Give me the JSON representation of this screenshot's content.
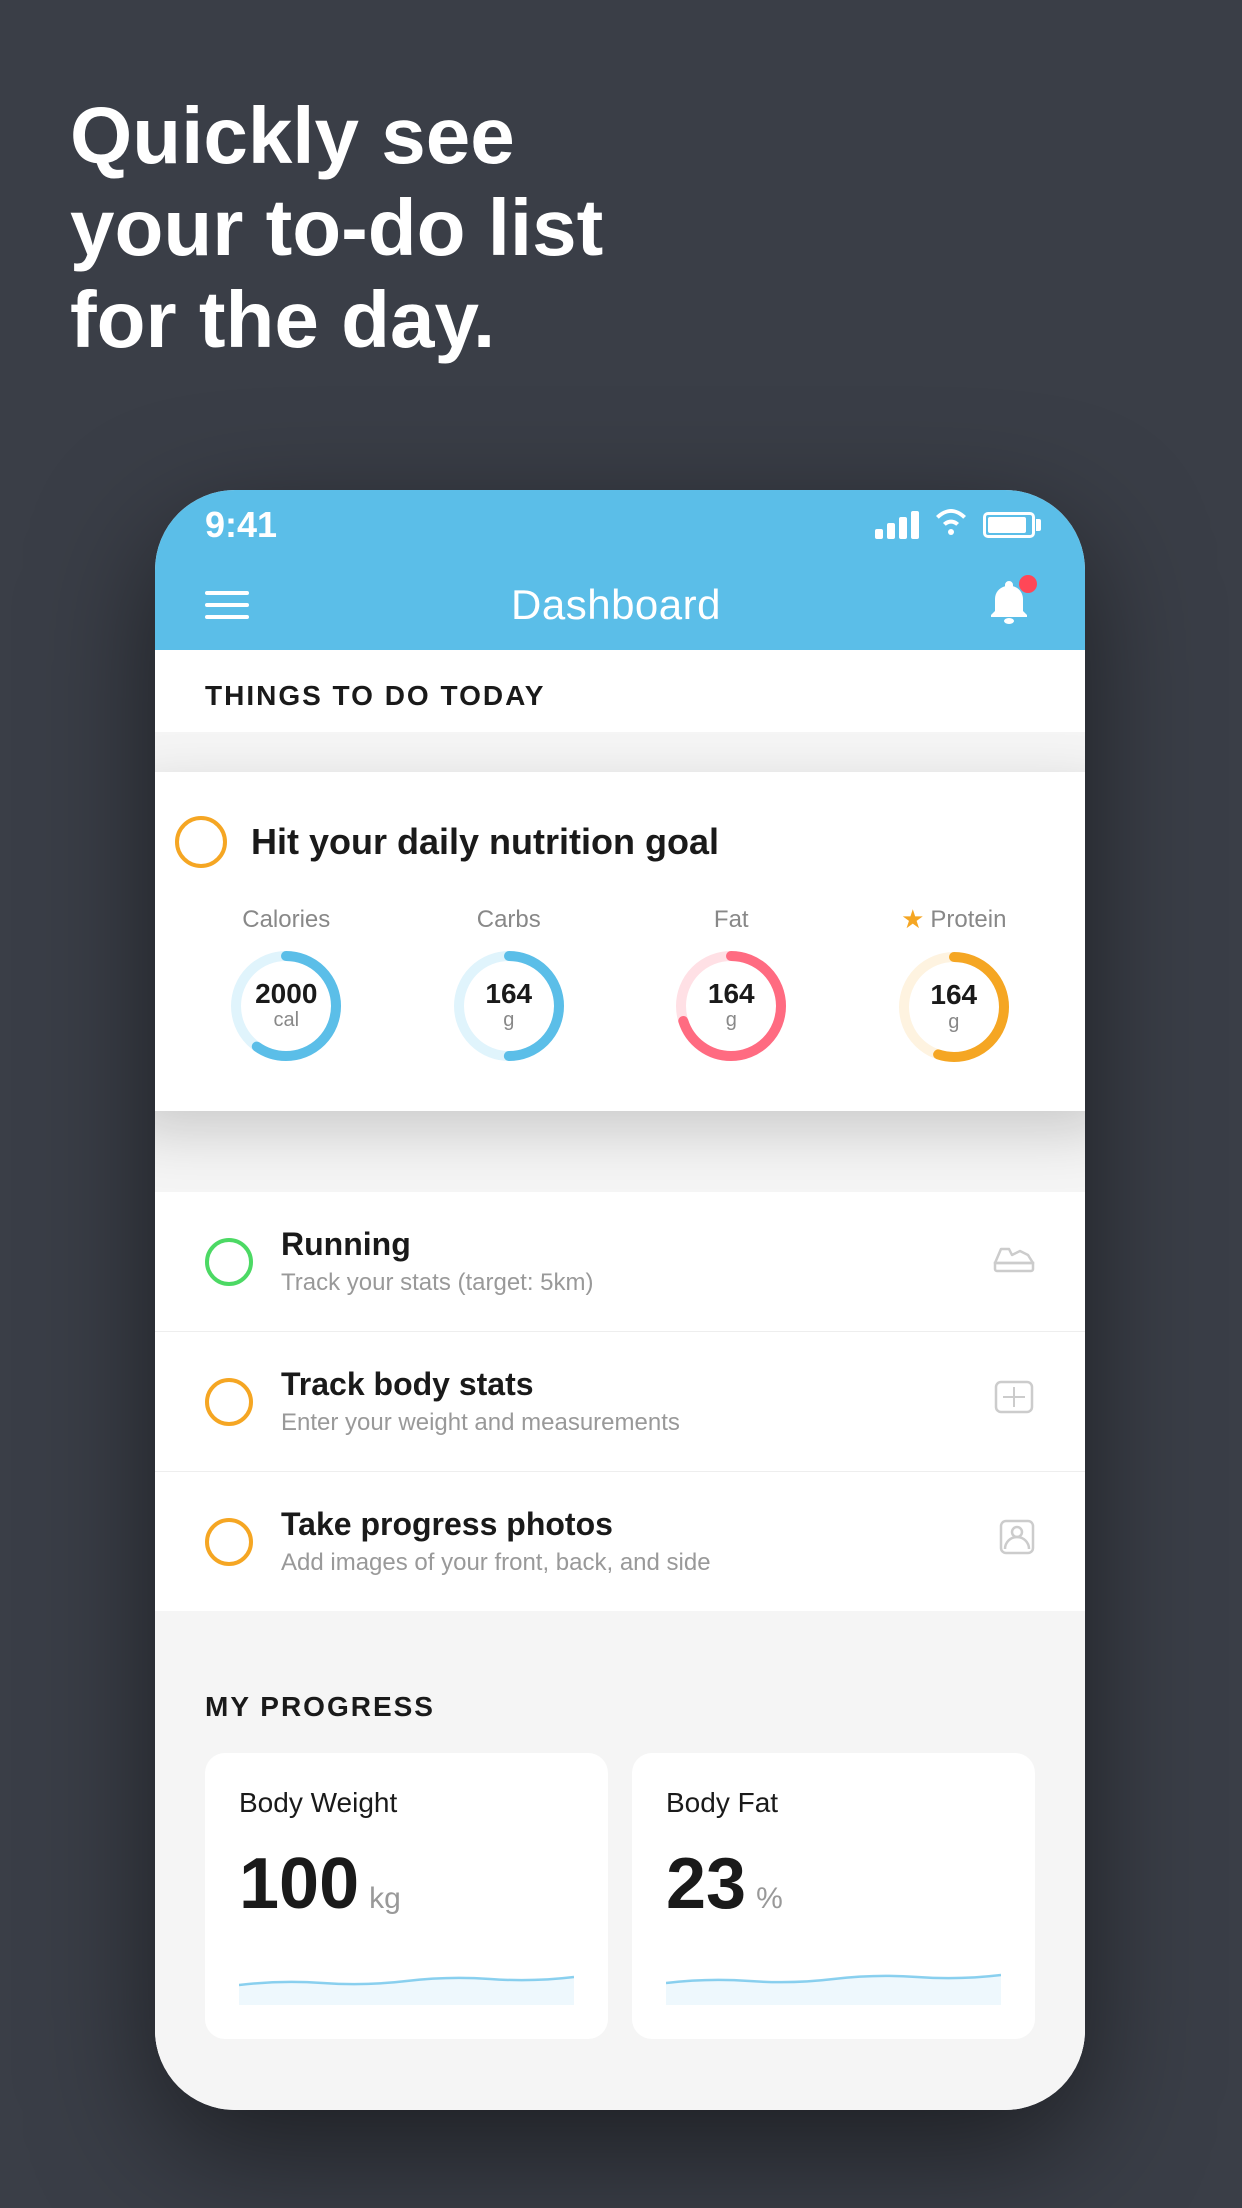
{
  "headline": {
    "line1": "Quickly see",
    "line2": "your to-do list",
    "line3": "for the day."
  },
  "phone": {
    "statusBar": {
      "time": "9:41"
    },
    "header": {
      "title": "Dashboard"
    },
    "sectionTitle": "THINGS TO DO TODAY",
    "floatingCard": {
      "checkboxColor": "#f5a623",
      "title": "Hit your daily nutrition goal",
      "calories": {
        "label": "Calories",
        "value": "2000",
        "unit": "cal",
        "color": "#5bbee8",
        "trackColor": "#e0f4fc",
        "progress": 0.6
      },
      "carbs": {
        "label": "Carbs",
        "value": "164",
        "unit": "g",
        "color": "#5bbee8",
        "trackColor": "#e0f4fc",
        "progress": 0.5
      },
      "fat": {
        "label": "Fat",
        "value": "164",
        "unit": "g",
        "color": "#ff6b81",
        "trackColor": "#ffe0e5",
        "progress": 0.7
      },
      "protein": {
        "label": "Protein",
        "value": "164",
        "unit": "g",
        "color": "#f5a623",
        "trackColor": "#fef3e0",
        "progress": 0.55
      }
    },
    "todoItems": [
      {
        "id": "running",
        "circleColor": "green",
        "title": "Running",
        "subtitle": "Track your stats (target: 5km)",
        "icon": "shoe"
      },
      {
        "id": "body-stats",
        "circleColor": "yellow",
        "title": "Track body stats",
        "subtitle": "Enter your weight and measurements",
        "icon": "scale"
      },
      {
        "id": "progress-photos",
        "circleColor": "yellow",
        "title": "Take progress photos",
        "subtitle": "Add images of your front, back, and side",
        "icon": "person"
      }
    ],
    "progressSection": {
      "title": "MY PROGRESS",
      "bodyWeight": {
        "label": "Body Weight",
        "value": "100",
        "unit": "kg"
      },
      "bodyFat": {
        "label": "Body Fat",
        "value": "23",
        "unit": "%"
      }
    }
  }
}
